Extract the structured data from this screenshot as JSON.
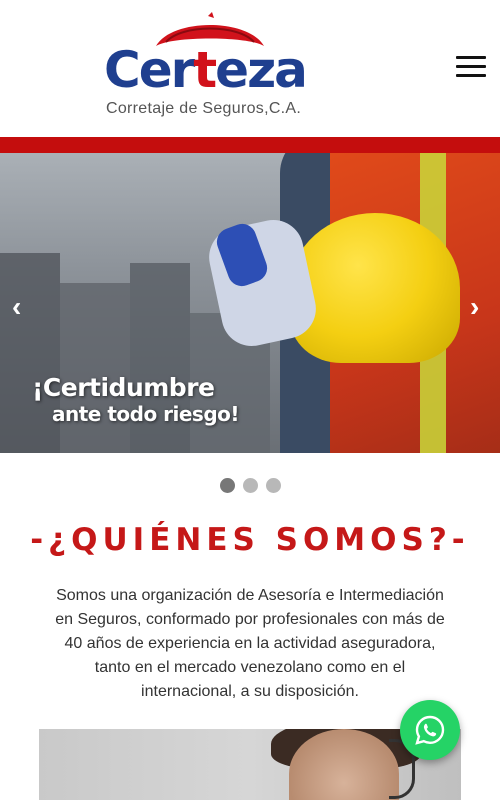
{
  "header": {
    "logo_text_1": "Cer",
    "logo_text_2": "t",
    "logo_text_3": "eza",
    "logo_subtitle": "Corretaje de Seguros,C.A.",
    "menu_icon": "hamburger-menu-icon"
  },
  "colors": {
    "brand_blue": "#1f3f8f",
    "brand_red": "#c40d0d",
    "title_red": "#c51818",
    "whatsapp_green": "#25d366"
  },
  "hero": {
    "headline_1": "¡Certidumbre",
    "headline_2": "ante todo riesgo!",
    "prev_arrow": "‹",
    "next_arrow": "›",
    "slide_count": 3,
    "active_slide": 1
  },
  "about": {
    "title": "-¿QUIÉNES SOMOS?-",
    "body": "Somos una organización de Asesoría e Intermediación en Seguros, conformado por profesionales con más de 40 años de experiencia en la actividad aseguradora, tanto en el mercado venezolano como en el internacional, a su disposición."
  },
  "whatsapp": {
    "icon": "whatsapp-icon"
  }
}
